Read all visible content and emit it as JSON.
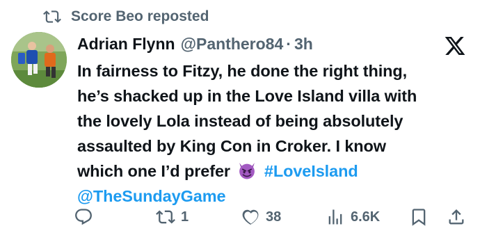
{
  "repost": {
    "label": "Score Beo reposted",
    "icon": "repost-icon"
  },
  "author": {
    "name": "Adrian Flynn",
    "handle": "@Panthero84",
    "separator": "·",
    "time": "3h",
    "avatar_icon": "avatar"
  },
  "platform_icon": "x-logo-icon",
  "tweet": {
    "lines": [
      "In fairness to Fitzy, he done the right thing,",
      "he’s shacked up in the Love Island villa with",
      "the lovely Lola instead of being absolutely",
      "assaulted by King Con in Croker. I know"
    ],
    "line5_prefix": "which one I’d prefer",
    "emoji_icon": "smiling-devil-emoji-icon",
    "hashtag": "#LoveIsland",
    "mention": "@TheSundayGame"
  },
  "actions": {
    "reply": {
      "icon": "reply-icon",
      "count": ""
    },
    "repost": {
      "icon": "repost-icon",
      "count": "1"
    },
    "like": {
      "icon": "heart-icon",
      "count": "38"
    },
    "views": {
      "icon": "views-icon",
      "count": "6.6K"
    },
    "bookmark": {
      "icon": "bookmark-icon"
    },
    "share": {
      "icon": "share-icon"
    }
  },
  "colors": {
    "text": "#0f1419",
    "muted": "#536471",
    "link": "#1d9bf0",
    "emoji": "#8e44ad"
  }
}
